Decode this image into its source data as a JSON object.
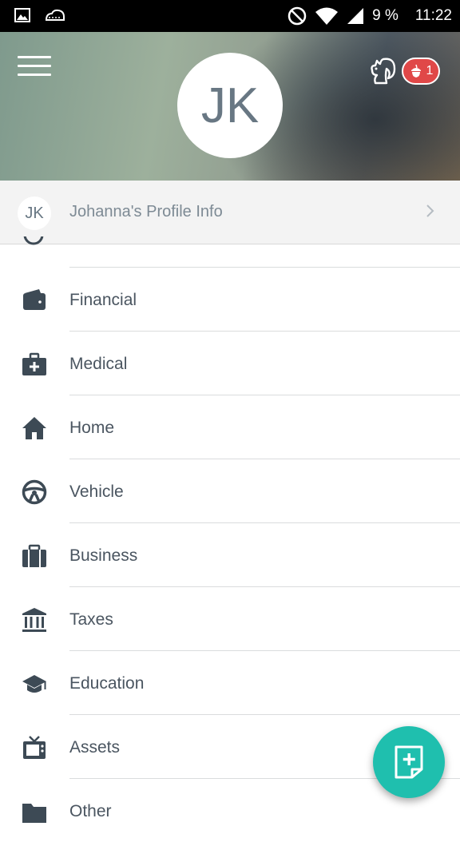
{
  "status_bar": {
    "battery_percent": "9 %",
    "time": "11:22",
    "icons": [
      "image-icon",
      "cloud-icon",
      "do-not-disturb-icon",
      "wifi-icon",
      "signal-icon",
      "battery-icon"
    ]
  },
  "header": {
    "avatar_initials": "JK",
    "rewards_badge_count": "1",
    "icons": [
      "menu-icon",
      "squirrel-icon",
      "acorn-icon"
    ]
  },
  "profile": {
    "avatar_initials": "JK",
    "label": "Johanna's Profile Info"
  },
  "menu": {
    "items": [
      {
        "label": "Financial",
        "icon": "wallet-icon"
      },
      {
        "label": "Medical",
        "icon": "medical-kit-icon"
      },
      {
        "label": "Home",
        "icon": "home-icon"
      },
      {
        "label": "Vehicle",
        "icon": "steering-wheel-icon"
      },
      {
        "label": "Business",
        "icon": "briefcase-icon"
      },
      {
        "label": "Taxes",
        "icon": "bank-icon"
      },
      {
        "label": "Education",
        "icon": "graduation-cap-icon"
      },
      {
        "label": "Assets",
        "icon": "tv-icon"
      },
      {
        "label": "Other",
        "icon": "folder-icon"
      }
    ]
  },
  "fab": {
    "icon": "add-document-icon"
  },
  "colors": {
    "icon": "#3d4a55",
    "text": "#4a5560",
    "fab": "#1fbfae",
    "badge": "#e04848",
    "status_bar": "#000000"
  }
}
